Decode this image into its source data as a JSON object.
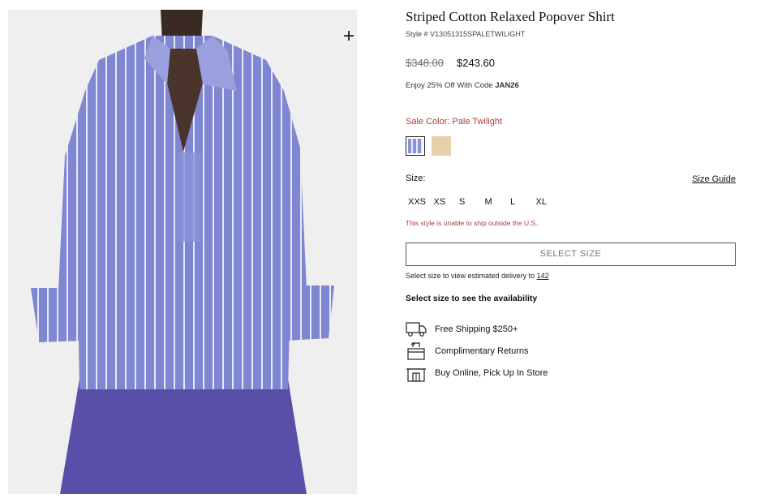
{
  "product": {
    "title": "Striped Cotton Relaxed Popover Shirt",
    "style_number": "Style # V13051315SPALETWILIGHT",
    "price_original": "$348.00",
    "price_sale": "$243.60",
    "promo_text": "Enjoy 25% Off With Code ",
    "promo_code": "JAN26"
  },
  "color": {
    "label": "Sale Color: Pale Twilight",
    "swatches": [
      {
        "name": "Pale Twilight",
        "color": "#8a93d6",
        "selected": true
      },
      {
        "name": "Sand",
        "color": "#e6d1ac",
        "selected": false
      }
    ]
  },
  "size": {
    "label": "Size:",
    "guide_label": "Size Guide",
    "options": [
      "XXS",
      "XS",
      "S",
      "M",
      "L",
      "XL"
    ],
    "shipping_warning": "This style is unable to ship outside the U.S.."
  },
  "select_size_button": "SELECT SIZE",
  "delivery": {
    "text": "Select size to view estimated delivery to ",
    "zip": "142"
  },
  "availability_text": "Select size to see the availability",
  "features": [
    {
      "icon": "truck-icon",
      "label": "Free Shipping $250+"
    },
    {
      "icon": "return-box-icon",
      "label": "Complimentary Returns"
    },
    {
      "icon": "store-icon",
      "label": "Buy Online, Pick Up In Store"
    }
  ],
  "image": {
    "zoom_symbol": "+",
    "shirt_color": "#7f86d2",
    "skirt_color": "#5a4fa8",
    "background": "#efefef"
  }
}
